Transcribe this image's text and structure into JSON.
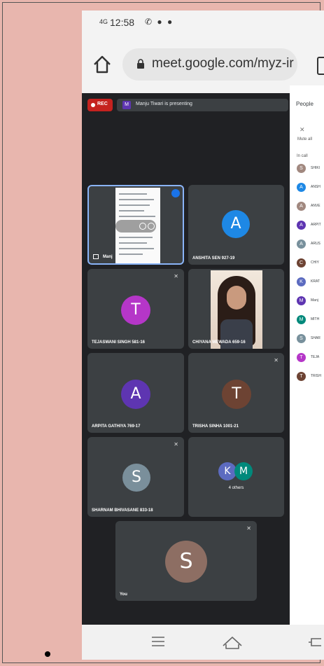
{
  "status": {
    "time": "12:58",
    "signal": "4G",
    "icons": "✆ ● ●"
  },
  "browser": {
    "url": "meet.google.com/myz-ir"
  },
  "meeting": {
    "rec_label": "REC",
    "presenting": {
      "initial": "M",
      "text": "Manju Tiwari is presenting"
    },
    "tiles": [
      {
        "name": "Manj",
        "type": "screen-share"
      },
      {
        "name": "ANSHITA SEN 927-19",
        "initial": "A",
        "color": "#1e88e5"
      },
      {
        "name": "TEJASWANI SINGH 581-16",
        "initial": "T",
        "color": "#b536c8",
        "muted": true
      },
      {
        "name": "CHIYANA MEWADA 659-16",
        "type": "video"
      },
      {
        "name": "ARPITA GATHIYA 769-17",
        "initial": "A",
        "color": "#5e35b1",
        "muted": true
      },
      {
        "name": "TRISHA SINHA 1001-21",
        "initial": "T",
        "color": "#6d4333",
        "muted": true
      },
      {
        "name": "SHARNAM BHIVASANE 833-18",
        "initial": "S",
        "color": "#7a8f9b",
        "muted": true
      },
      {
        "label": "4 others",
        "initials": [
          "K",
          "M"
        ],
        "colors": [
          "#5c6bc0",
          "#00897b"
        ]
      },
      {
        "name": "You",
        "initial": "S",
        "color": "#8d6e63",
        "muted": true
      }
    ]
  },
  "people_panel": {
    "title": "People",
    "mute_all": "Mute all",
    "in_call": "In call",
    "participants": [
      {
        "initial": "S",
        "name": "SHIKI",
        "color": "#a1887f"
      },
      {
        "initial": "A",
        "name": "ANSH",
        "color": "#1e88e5"
      },
      {
        "initial": "A",
        "name": "ANVE",
        "color": "#a1887f"
      },
      {
        "initial": "A",
        "name": "ARPIT",
        "color": "#5e35b1"
      },
      {
        "initial": "A",
        "name": "ARUS",
        "color": "#78909c"
      },
      {
        "initial": "C",
        "name": "CHIY",
        "color": "#6d4333"
      },
      {
        "initial": "K",
        "name": "KRAT",
        "color": "#5c6bc0"
      },
      {
        "initial": "M",
        "name": "Manj",
        "color": "#5e35b1"
      },
      {
        "initial": "M",
        "name": "MITH",
        "color": "#00897b"
      },
      {
        "initial": "S",
        "name": "SHAR",
        "color": "#78909c"
      },
      {
        "initial": "T",
        "name": "TEJA",
        "color": "#b536c8"
      },
      {
        "initial": "T",
        "name": "TRISH",
        "color": "#6d4333"
      }
    ]
  }
}
